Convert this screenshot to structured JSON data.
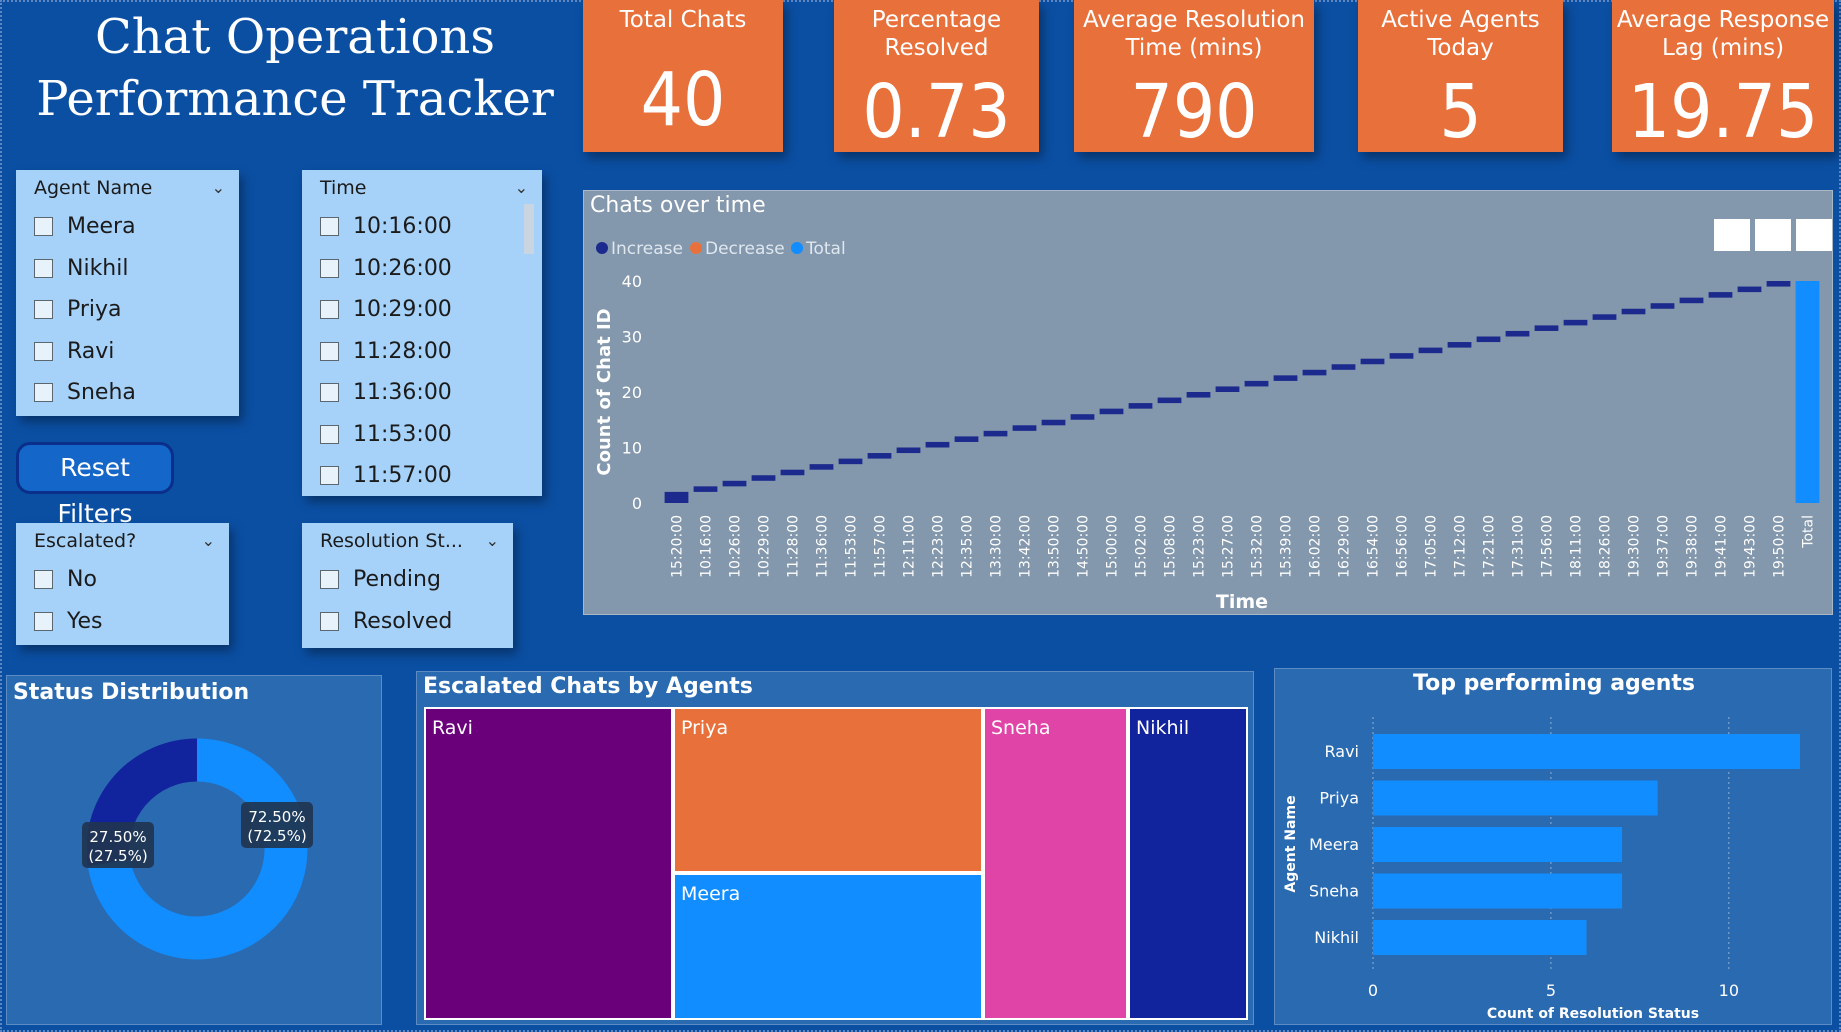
{
  "header": {
    "title_line1": "Chat Operations",
    "title_line2": "Performance Tracker"
  },
  "kpis": [
    {
      "label": "Total Chats",
      "value": "40"
    },
    {
      "label": "Percentage Resolved",
      "value": "0.73"
    },
    {
      "label": "Average Resolution Time (mins)",
      "value": "790"
    },
    {
      "label": "Active Agents Today",
      "value": "5"
    },
    {
      "label": "Average Response Lag (mins)",
      "value": "19.75"
    }
  ],
  "filters": {
    "agent": {
      "title": "Agent Name",
      "items": [
        "Meera",
        "Nikhil",
        "Priya",
        "Ravi",
        "Sneha"
      ]
    },
    "time": {
      "title": "Time",
      "items": [
        "10:16:00",
        "10:26:00",
        "10:29:00",
        "11:28:00",
        "11:36:00",
        "11:53:00",
        "11:57:00"
      ]
    },
    "escalated": {
      "title": "Escalated?",
      "items": [
        "No",
        "Yes"
      ]
    },
    "resolution": {
      "title": "Resolution St...",
      "items": [
        "Pending",
        "Resolved"
      ]
    },
    "reset_label": "Reset Filters"
  },
  "colors": {
    "background": "#0B4FA3",
    "kpi": "#E8703A",
    "increase": "#1B2A8C",
    "decrease": "#E8703A",
    "total": "#118DFF"
  },
  "chart_data": [
    {
      "type": "bar",
      "subtype": "waterfall",
      "title": "Chats over time",
      "xlabel": "Time",
      "ylabel": "Count of Chat ID",
      "legend": [
        "Increase",
        "Decrease",
        "Total"
      ],
      "legend_position": "top-left",
      "ylim": [
        0,
        40
      ],
      "yticks": [
        0,
        10,
        20,
        30,
        40
      ],
      "categories": [
        "15:20:00",
        "10:16:00",
        "10:26:00",
        "10:29:00",
        "11:28:00",
        "11:36:00",
        "11:53:00",
        "11:57:00",
        "12:11:00",
        "12:23:00",
        "12:35:00",
        "13:30:00",
        "13:42:00",
        "13:50:00",
        "14:50:00",
        "15:00:00",
        "15:02:00",
        "15:08:00",
        "15:23:00",
        "15:27:00",
        "15:32:00",
        "15:39:00",
        "16:02:00",
        "16:29:00",
        "16:54:00",
        "16:56:00",
        "17:05:00",
        "17:12:00",
        "17:21:00",
        "17:31:00",
        "17:56:00",
        "18:11:00",
        "18:26:00",
        "19:30:00",
        "19:37:00",
        "19:38:00",
        "19:41:00",
        "19:43:00",
        "19:50:00",
        "Total"
      ],
      "values": [
        2,
        1,
        1,
        1,
        1,
        1,
        1,
        1,
        1,
        1,
        1,
        1,
        1,
        1,
        1,
        1,
        1,
        1,
        1,
        1,
        1,
        1,
        1,
        1,
        1,
        1,
        1,
        1,
        1,
        1,
        1,
        1,
        1,
        1,
        1,
        1,
        1,
        1,
        1,
        40
      ]
    },
    {
      "type": "pie",
      "subtype": "donut",
      "title": "Status Distribution",
      "slices": [
        {
          "label": "72.50%",
          "sublabel": "(72.5%)",
          "value": 72.5,
          "color": "#118DFF"
        },
        {
          "label": "27.50%",
          "sublabel": "(27.5%)",
          "value": 27.5,
          "color": "#12239E"
        }
      ]
    },
    {
      "type": "heatmap",
      "subtype": "treemap",
      "title": "Escalated Chats by Agents",
      "cells": [
        {
          "label": "Ravi",
          "color": "#6B007B"
        },
        {
          "label": "Priya",
          "color": "#E8703A"
        },
        {
          "label": "Meera",
          "color": "#118DFF"
        },
        {
          "label": "Sneha",
          "color": "#E044A7"
        },
        {
          "label": "Nikhil",
          "color": "#12239E"
        }
      ]
    },
    {
      "type": "bar",
      "orientation": "horizontal",
      "title": "Top performing agents",
      "xlabel": "Count of Resolution Status",
      "ylabel": "Agent Name",
      "categories": [
        "Ravi",
        "Priya",
        "Meera",
        "Sneha",
        "Nikhil"
      ],
      "values": [
        12,
        8,
        7,
        7,
        6
      ],
      "xlim": [
        0,
        12
      ],
      "xticks": [
        0,
        5,
        10
      ]
    }
  ]
}
